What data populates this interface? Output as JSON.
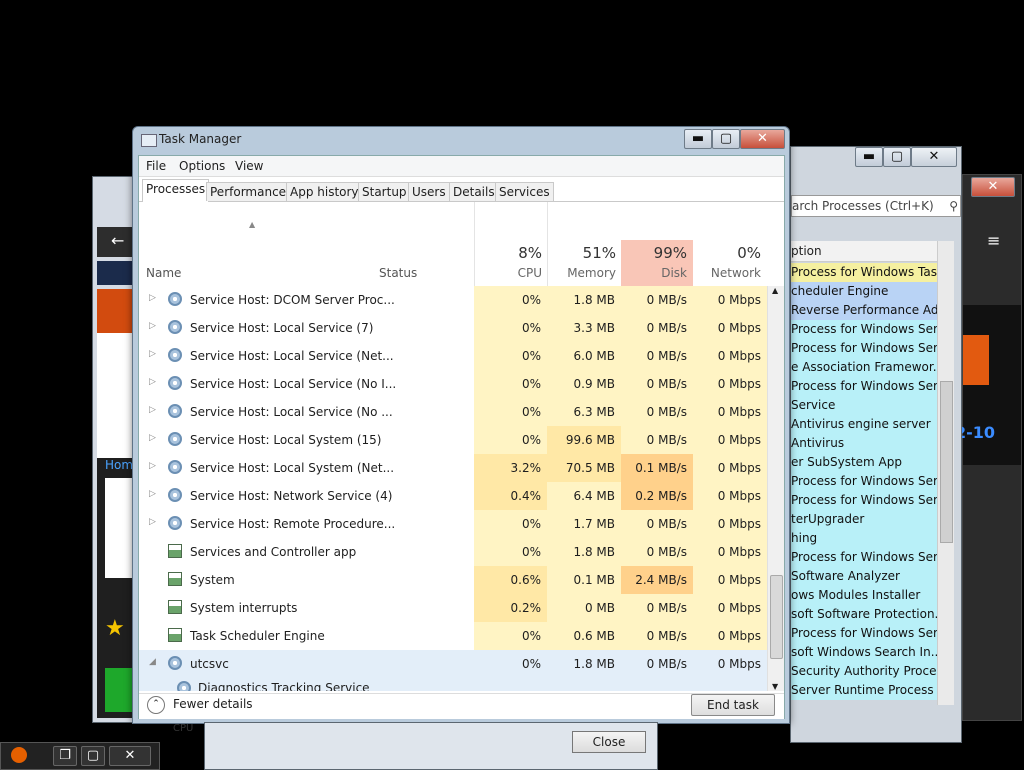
{
  "background_window": {
    "search_placeholder": "arch Processes (Ctrl+K)",
    "column_header": "ption",
    "left_home_text": "Hom",
    "left_rating_icon": "star-icon",
    "right_badge_text": "2-10",
    "service_descriptions": [
      "Process for Windows Tas...",
      "cheduler Engine",
      "Reverse Performance Ad...",
      "Process for Windows Ser...",
      "Process for Windows Ser...",
      "e Association Framewor...",
      "Process for Windows Ser...",
      "Service",
      "Antivirus engine server",
      "Antivirus",
      "er SubSystem App",
      "Process for Windows Ser...",
      "Process for Windows Ser...",
      "terUpgrader",
      "hing",
      "Process for Windows Ser...",
      "Software Analyzer",
      "ows Modules Installer",
      "soft Software Protection...",
      "Process for Windows Ser...",
      "soft Windows Search In...",
      "Security Authority Proce...",
      "Server Runtime Process"
    ],
    "dialog_close_label": "Close",
    "dialog_label": "CPU"
  },
  "task_manager": {
    "title": "Task Manager",
    "menu": [
      "File",
      "Options",
      "View"
    ],
    "tabs": [
      "Processes",
      "Performance",
      "App history",
      "Startup",
      "Users",
      "Details",
      "Services"
    ],
    "active_tab": "Processes",
    "columns": {
      "name": "Name",
      "status": "Status",
      "cpu": {
        "label": "CPU",
        "pct": "8%"
      },
      "memory": {
        "label": "Memory",
        "pct": "51%"
      },
      "disk": {
        "label": "Disk",
        "pct": "99%"
      },
      "network": {
        "label": "Network",
        "pct": "0%"
      }
    },
    "rows": [
      {
        "name": "Service Host: DCOM Server Proc...",
        "cpu": "0%",
        "mem": "1.8 MB",
        "disk": "0 MB/s",
        "net": "0 Mbps",
        "expand": "▷",
        "icon": "gear"
      },
      {
        "name": "Service Host: Local Service (7)",
        "cpu": "0%",
        "mem": "3.3 MB",
        "disk": "0 MB/s",
        "net": "0 Mbps",
        "expand": "▷",
        "icon": "gear"
      },
      {
        "name": "Service Host: Local Service (Net...",
        "cpu": "0%",
        "mem": "6.0 MB",
        "disk": "0 MB/s",
        "net": "0 Mbps",
        "expand": "▷",
        "icon": "gear"
      },
      {
        "name": "Service Host: Local Service (No I...",
        "cpu": "0%",
        "mem": "0.9 MB",
        "disk": "0 MB/s",
        "net": "0 Mbps",
        "expand": "▷",
        "icon": "gear"
      },
      {
        "name": "Service Host: Local Service (No ...",
        "cpu": "0%",
        "mem": "6.3 MB",
        "disk": "0 MB/s",
        "net": "0 Mbps",
        "expand": "▷",
        "icon": "gear"
      },
      {
        "name": "Service Host: Local System (15)",
        "cpu": "0%",
        "mem": "99.6 MB",
        "disk": "0 MB/s",
        "net": "0 Mbps",
        "expand": "▷",
        "icon": "gear"
      },
      {
        "name": "Service Host: Local System (Net...",
        "cpu": "3.2%",
        "mem": "70.5 MB",
        "disk": "0.1 MB/s",
        "net": "0 Mbps",
        "expand": "▷",
        "icon": "gear"
      },
      {
        "name": "Service Host: Network Service (4)",
        "cpu": "0.4%",
        "mem": "6.4 MB",
        "disk": "0.2 MB/s",
        "net": "0 Mbps",
        "expand": "▷",
        "icon": "gear"
      },
      {
        "name": "Service Host: Remote Procedure...",
        "cpu": "0%",
        "mem": "1.7 MB",
        "disk": "0 MB/s",
        "net": "0 Mbps",
        "expand": "▷",
        "icon": "gear"
      },
      {
        "name": "Services and Controller app",
        "cpu": "0%",
        "mem": "1.8 MB",
        "disk": "0 MB/s",
        "net": "0 Mbps",
        "expand": "",
        "icon": "app"
      },
      {
        "name": "System",
        "cpu": "0.6%",
        "mem": "0.1 MB",
        "disk": "2.4 MB/s",
        "net": "0 Mbps",
        "expand": "",
        "icon": "app"
      },
      {
        "name": "System interrupts",
        "cpu": "0.2%",
        "mem": "0 MB",
        "disk": "0 MB/s",
        "net": "0 Mbps",
        "expand": "",
        "icon": "app"
      },
      {
        "name": "Task Scheduler Engine",
        "cpu": "0%",
        "mem": "0.6 MB",
        "disk": "0 MB/s",
        "net": "0 Mbps",
        "expand": "",
        "icon": "app"
      },
      {
        "name": "utcsvc",
        "cpu": "0%",
        "mem": "1.8 MB",
        "disk": "0 MB/s",
        "net": "0 Mbps",
        "expand": "◢",
        "icon": "gear",
        "selected": true
      },
      {
        "name": "Diagnostics Tracking Service",
        "cpu": "",
        "mem": "",
        "disk": "",
        "net": "",
        "expand": "",
        "icon": "gear-small",
        "child": true,
        "selected": true
      }
    ],
    "footer": {
      "fewer_details": "Fewer details",
      "end_task": "End task"
    }
  },
  "colors": {
    "cpu_low": "#fff4c4",
    "cpu_mid": "#ffe8a6",
    "disk_hot": "#ffd18b",
    "disk_header": "#f9c6b7",
    "row_selected": "#e3eef9"
  }
}
